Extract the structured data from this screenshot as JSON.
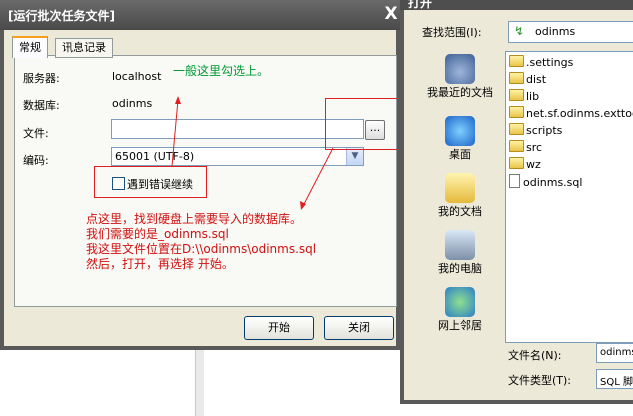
{
  "run_dialog": {
    "title": "[运行批次任务文件]",
    "close_symbol": "X",
    "tabs": [
      {
        "label": "常规"
      },
      {
        "label": "讯息记录"
      }
    ],
    "server_label": "服务器:",
    "server_value": "localhost",
    "database_label": "数据库:",
    "database_value": "odinms",
    "file_label": "文件:",
    "file_value": "",
    "browse_label": "...",
    "encoding_label": "编码:",
    "encoding_value": "65001 (UTF-8)",
    "continue_on_error_label": "遇到错误继续",
    "continue_on_error_checked": false,
    "start_button": "开始",
    "close_button": "关闭"
  },
  "annotations": {
    "green_note": "一般这里勾选上。",
    "red_lines": [
      "点这里，找到硬盘上需要导入的数据库。",
      "我们需要的是_odinms.sql",
      "我这里文件位置在D:\\\\odinms\\odinms.sql",
      "然后，打开，再选择 开始。"
    ]
  },
  "open_dialog": {
    "title": "打开",
    "look_in_label": "查找范围(I):",
    "look_in_value": "odinms",
    "places": [
      {
        "label": "我最近的文档",
        "icon": "recent-documents-icon"
      },
      {
        "label": "桌面",
        "icon": "desktop-icon"
      },
      {
        "label": "我的文档",
        "icon": "my-documents-icon"
      },
      {
        "label": "我的电脑",
        "icon": "my-computer-icon"
      },
      {
        "label": "网上邻居",
        "icon": "network-places-icon"
      }
    ],
    "files": [
      {
        "name": ".settings",
        "kind": "folder"
      },
      {
        "name": "dist",
        "kind": "folder"
      },
      {
        "name": "lib",
        "kind": "folder"
      },
      {
        "name": "net.sf.odinms.exttoo",
        "kind": "folder"
      },
      {
        "name": "scripts",
        "kind": "folder"
      },
      {
        "name": "src",
        "kind": "folder"
      },
      {
        "name": "wz",
        "kind": "folder"
      },
      {
        "name": "odinms.sql",
        "kind": "file"
      }
    ],
    "filename_label": "文件名(N):",
    "filename_value": "odinms",
    "filetype_label": "文件类型(T):",
    "filetype_value": "SQL 脚"
  },
  "colors": {
    "accent_orange": "#f4a01c",
    "annotation_red": "#d01010",
    "annotation_green": "#009933",
    "titlebar": "#5a5a5a"
  }
}
